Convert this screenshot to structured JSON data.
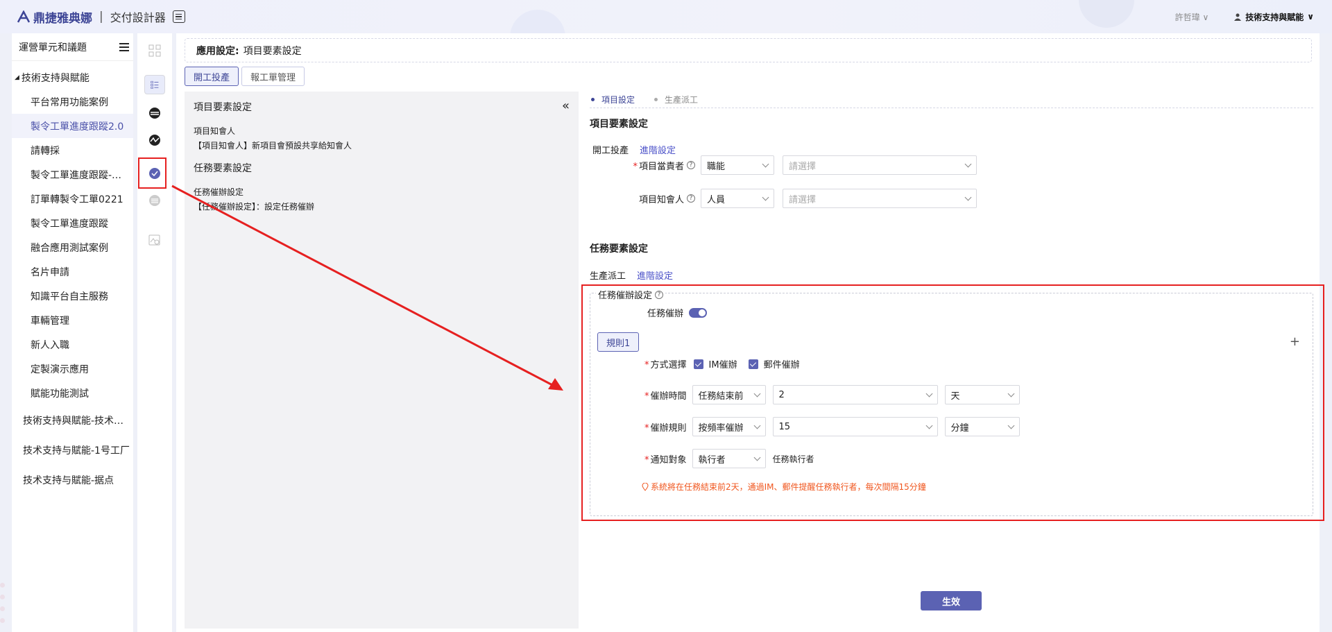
{
  "topbar": {
    "brand": "鼎捷雅典娜",
    "separator": "|",
    "product": "交付設計器",
    "user": "許哲瑋",
    "org": "技術支持與賦能"
  },
  "sidebar": {
    "title": "運營單元和議題",
    "root": "技術支持與賦能",
    "children": [
      "平台常用功能案例",
      "製令工單進度跟蹤2.0",
      "請轉採",
      "製令工單進度跟蹤-…",
      "訂單轉製令工單0221",
      "製令工單進度跟蹤",
      "融合應用測試案例",
      "名片申請",
      "知識平台自主服務",
      "車輛管理",
      "新人入職",
      "定製演示應用",
      "賦能功能測試"
    ],
    "active_index": 1,
    "top_items": [
      "技術支持與賦能-技术…",
      "技术支持与賦能-1号工厂",
      "技术支持与賦能-据点"
    ]
  },
  "breadcrumb": {
    "prefix": "應用設定:",
    "current": "項目要素設定"
  },
  "tabs": [
    {
      "label": "開工投產",
      "active": true
    },
    {
      "label": "報工單管理",
      "active": false
    }
  ],
  "left_pane": {
    "project_title": "項目要素設定",
    "notify_label": "項目知會人",
    "notify_text": "【項目知會人】新項目會預設共享給知會人",
    "task_title": "任務要素設定",
    "urge_label": "任務催辦設定",
    "urge_text": "【任務催辦設定】：設定任務催辦"
  },
  "steps": [
    {
      "label": "項目設定",
      "active": true
    },
    {
      "label": "生產派工",
      "active": false
    }
  ],
  "project_section": {
    "title": "項目要素設定",
    "sub_label": "開工投產",
    "advanced_link": "進階設定",
    "owner": {
      "label": "項目當責者",
      "type_value": "職能",
      "select_placeholder": "請選擇"
    },
    "notifier": {
      "label": "項目知會人",
      "type_value": "人員",
      "select_placeholder": "請選擇"
    }
  },
  "task_section": {
    "title": "任務要素設定",
    "sub_label": "生產派工",
    "advanced_link": "進階設定",
    "urge_box_title": "任務催辦設定",
    "urge_toggle_label": "任務催辦",
    "urge_toggle_on": true,
    "rule_tag": "規則1",
    "add_icon": "plus-icon",
    "method": {
      "label": "方式選擇",
      "options": [
        "IM催辦",
        "郵件催辦"
      ]
    },
    "urge_time": {
      "label": "催辦時間",
      "when": "任務結束前",
      "amount": "2",
      "unit": "天"
    },
    "urge_rule": {
      "label": "催辦規則",
      "mode": "按頻率催辦",
      "interval": "15",
      "unit": "分鐘"
    },
    "target": {
      "label": "通知對象",
      "value": "執行者",
      "desc": "任務執行者"
    },
    "hint": "系統將在任務結束前2天，通過IM、郵件提醒任務執行者，每次間隔15分鐘"
  },
  "apply_button": "生效",
  "colors": {
    "accent": "#5b62b3",
    "annotation": "#e62020",
    "hint": "#f0561e"
  }
}
